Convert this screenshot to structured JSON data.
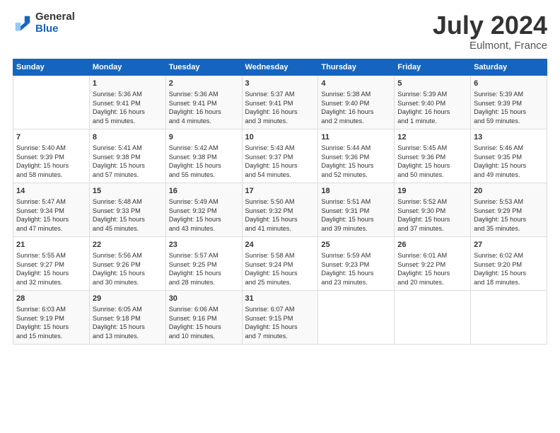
{
  "logo": {
    "general": "General",
    "blue": "Blue"
  },
  "title": "July 2024",
  "subtitle": "Eulmont, France",
  "headers": [
    "Sunday",
    "Monday",
    "Tuesday",
    "Wednesday",
    "Thursday",
    "Friday",
    "Saturday"
  ],
  "weeks": [
    [
      {
        "day": "",
        "lines": []
      },
      {
        "day": "1",
        "lines": [
          "Sunrise: 5:36 AM",
          "Sunset: 9:41 PM",
          "Daylight: 16 hours",
          "and 5 minutes."
        ]
      },
      {
        "day": "2",
        "lines": [
          "Sunrise: 5:36 AM",
          "Sunset: 9:41 PM",
          "Daylight: 16 hours",
          "and 4 minutes."
        ]
      },
      {
        "day": "3",
        "lines": [
          "Sunrise: 5:37 AM",
          "Sunset: 9:41 PM",
          "Daylight: 16 hours",
          "and 3 minutes."
        ]
      },
      {
        "day": "4",
        "lines": [
          "Sunrise: 5:38 AM",
          "Sunset: 9:40 PM",
          "Daylight: 16 hours",
          "and 2 minutes."
        ]
      },
      {
        "day": "5",
        "lines": [
          "Sunrise: 5:39 AM",
          "Sunset: 9:40 PM",
          "Daylight: 16 hours",
          "and 1 minute."
        ]
      },
      {
        "day": "6",
        "lines": [
          "Sunrise: 5:39 AM",
          "Sunset: 9:39 PM",
          "Daylight: 15 hours",
          "and 59 minutes."
        ]
      }
    ],
    [
      {
        "day": "7",
        "lines": [
          "Sunrise: 5:40 AM",
          "Sunset: 9:39 PM",
          "Daylight: 15 hours",
          "and 58 minutes."
        ]
      },
      {
        "day": "8",
        "lines": [
          "Sunrise: 5:41 AM",
          "Sunset: 9:38 PM",
          "Daylight: 15 hours",
          "and 57 minutes."
        ]
      },
      {
        "day": "9",
        "lines": [
          "Sunrise: 5:42 AM",
          "Sunset: 9:38 PM",
          "Daylight: 15 hours",
          "and 55 minutes."
        ]
      },
      {
        "day": "10",
        "lines": [
          "Sunrise: 5:43 AM",
          "Sunset: 9:37 PM",
          "Daylight: 15 hours",
          "and 54 minutes."
        ]
      },
      {
        "day": "11",
        "lines": [
          "Sunrise: 5:44 AM",
          "Sunset: 9:36 PM",
          "Daylight: 15 hours",
          "and 52 minutes."
        ]
      },
      {
        "day": "12",
        "lines": [
          "Sunrise: 5:45 AM",
          "Sunset: 9:36 PM",
          "Daylight: 15 hours",
          "and 50 minutes."
        ]
      },
      {
        "day": "13",
        "lines": [
          "Sunrise: 5:46 AM",
          "Sunset: 9:35 PM",
          "Daylight: 15 hours",
          "and 49 minutes."
        ]
      }
    ],
    [
      {
        "day": "14",
        "lines": [
          "Sunrise: 5:47 AM",
          "Sunset: 9:34 PM",
          "Daylight: 15 hours",
          "and 47 minutes."
        ]
      },
      {
        "day": "15",
        "lines": [
          "Sunrise: 5:48 AM",
          "Sunset: 9:33 PM",
          "Daylight: 15 hours",
          "and 45 minutes."
        ]
      },
      {
        "day": "16",
        "lines": [
          "Sunrise: 5:49 AM",
          "Sunset: 9:32 PM",
          "Daylight: 15 hours",
          "and 43 minutes."
        ]
      },
      {
        "day": "17",
        "lines": [
          "Sunrise: 5:50 AM",
          "Sunset: 9:32 PM",
          "Daylight: 15 hours",
          "and 41 minutes."
        ]
      },
      {
        "day": "18",
        "lines": [
          "Sunrise: 5:51 AM",
          "Sunset: 9:31 PM",
          "Daylight: 15 hours",
          "and 39 minutes."
        ]
      },
      {
        "day": "19",
        "lines": [
          "Sunrise: 5:52 AM",
          "Sunset: 9:30 PM",
          "Daylight: 15 hours",
          "and 37 minutes."
        ]
      },
      {
        "day": "20",
        "lines": [
          "Sunrise: 5:53 AM",
          "Sunset: 9:29 PM",
          "Daylight: 15 hours",
          "and 35 minutes."
        ]
      }
    ],
    [
      {
        "day": "21",
        "lines": [
          "Sunrise: 5:55 AM",
          "Sunset: 9:27 PM",
          "Daylight: 15 hours",
          "and 32 minutes."
        ]
      },
      {
        "day": "22",
        "lines": [
          "Sunrise: 5:56 AM",
          "Sunset: 9:26 PM",
          "Daylight: 15 hours",
          "and 30 minutes."
        ]
      },
      {
        "day": "23",
        "lines": [
          "Sunrise: 5:57 AM",
          "Sunset: 9:25 PM",
          "Daylight: 15 hours",
          "and 28 minutes."
        ]
      },
      {
        "day": "24",
        "lines": [
          "Sunrise: 5:58 AM",
          "Sunset: 9:24 PM",
          "Daylight: 15 hours",
          "and 25 minutes."
        ]
      },
      {
        "day": "25",
        "lines": [
          "Sunrise: 5:59 AM",
          "Sunset: 9:23 PM",
          "Daylight: 15 hours",
          "and 23 minutes."
        ]
      },
      {
        "day": "26",
        "lines": [
          "Sunrise: 6:01 AM",
          "Sunset: 9:22 PM",
          "Daylight: 15 hours",
          "and 20 minutes."
        ]
      },
      {
        "day": "27",
        "lines": [
          "Sunrise: 6:02 AM",
          "Sunset: 9:20 PM",
          "Daylight: 15 hours",
          "and 18 minutes."
        ]
      }
    ],
    [
      {
        "day": "28",
        "lines": [
          "Sunrise: 6:03 AM",
          "Sunset: 9:19 PM",
          "Daylight: 15 hours",
          "and 15 minutes."
        ]
      },
      {
        "day": "29",
        "lines": [
          "Sunrise: 6:05 AM",
          "Sunset: 9:18 PM",
          "Daylight: 15 hours",
          "and 13 minutes."
        ]
      },
      {
        "day": "30",
        "lines": [
          "Sunrise: 6:06 AM",
          "Sunset: 9:16 PM",
          "Daylight: 15 hours",
          "and 10 minutes."
        ]
      },
      {
        "day": "31",
        "lines": [
          "Sunrise: 6:07 AM",
          "Sunset: 9:15 PM",
          "Daylight: 15 hours",
          "and 7 minutes."
        ]
      },
      {
        "day": "",
        "lines": []
      },
      {
        "day": "",
        "lines": []
      },
      {
        "day": "",
        "lines": []
      }
    ]
  ]
}
